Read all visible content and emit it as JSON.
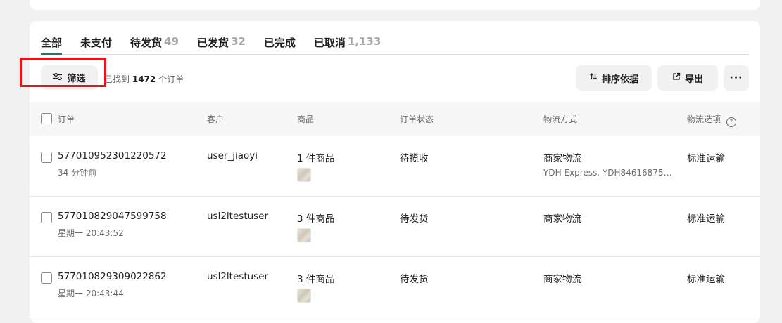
{
  "tabs": [
    {
      "label": "全部",
      "count": ""
    },
    {
      "label": "未支付",
      "count": ""
    },
    {
      "label": "待发货",
      "count": "49"
    },
    {
      "label": "已发货",
      "count": "32"
    },
    {
      "label": "已完成",
      "count": ""
    },
    {
      "label": "已取消",
      "count": "1,133"
    }
  ],
  "toolbar": {
    "filter_label": "筛选",
    "found_prefix": "已找到",
    "found_count": "1472",
    "found_suffix": "个订单",
    "sort_label": "排序依据",
    "export_label": "导出",
    "more_label": "···"
  },
  "table": {
    "headers": {
      "order": "订单",
      "customer": "客户",
      "goods": "商品",
      "status": "订单状态",
      "shipping": "物流方式",
      "shipping_option": "物流选项"
    },
    "rows": [
      {
        "order_id": "577010952301220572",
        "time": "34 分钟前",
        "customer": "user_jiaoyi",
        "goods": "1 件商品",
        "status": "待揽收",
        "shipping": "商家物流",
        "tracking": "YDH Express, YDH84616875…",
        "option": "标准运输"
      },
      {
        "order_id": "577010829047599758",
        "time": "星期一 20:43:52",
        "customer": "usl2ltestuser",
        "goods": "3 件商品",
        "status": "待发货",
        "shipping": "商家物流",
        "tracking": "",
        "option": "标准运输"
      },
      {
        "order_id": "577010829309022862",
        "time": "星期一 20:43:44",
        "customer": "usl2ltestuser",
        "goods": "3 件商品",
        "status": "待发货",
        "shipping": "商家物流",
        "tracking": "",
        "option": "标准运输"
      }
    ]
  },
  "colors": {
    "active_tab_underline": "#1f7a72",
    "highlight_box": "#e3141b"
  },
  "icons": {
    "filter": "sliders-icon",
    "sort": "sort-arrows-icon",
    "export": "external-link-icon",
    "help": "question-circle-icon"
  }
}
